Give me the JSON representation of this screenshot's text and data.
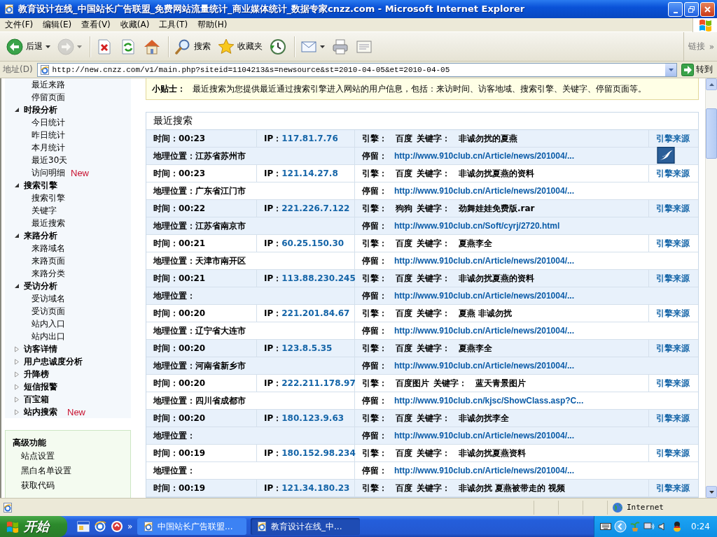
{
  "window": {
    "title": "教育设计在线_中国站长广告联盟_免费网站流量统计_商业媒体统计_数据专家cnzz.com - Microsoft Internet Explorer"
  },
  "menu": [
    "文件(F)",
    "编辑(E)",
    "查看(V)",
    "收藏(A)",
    "工具(T)",
    "帮助(H)"
  ],
  "toolbar": {
    "buttons": [
      {
        "kind": "back",
        "label": "后退",
        "disabled": false
      },
      {
        "kind": "forward",
        "disabled": true
      },
      {
        "kind": "stop",
        "disabled": false
      },
      {
        "kind": "refresh",
        "disabled": false
      },
      {
        "kind": "home",
        "disabled": false
      },
      {
        "kind": "search",
        "label": "搜索",
        "disabled": false
      },
      {
        "kind": "favorites",
        "label": "收藏夹",
        "disabled": false
      },
      {
        "kind": "history",
        "disabled": false
      },
      {
        "kind": "mail",
        "disabled": false
      },
      {
        "kind": "print",
        "disabled": false
      },
      {
        "kind": "edit",
        "disabled": false
      }
    ],
    "links": "链接",
    "more": "»"
  },
  "address": {
    "label": "地址(D)",
    "value": "http://new.cnzz.com/v1/main.php?siteid=1104213&s=newsource&st=2010-04-05&et=2010-04-05",
    "go": "转到"
  },
  "sidebar": {
    "continued_items": [
      {
        "label": "最近来路"
      },
      {
        "label": "停留页面"
      }
    ],
    "groups": [
      {
        "label": "时段分析",
        "expanded": true,
        "children": [
          {
            "label": "今日统计"
          },
          {
            "label": "昨日统计"
          },
          {
            "label": "本月统计"
          },
          {
            "label": "最近30天"
          },
          {
            "label": "访问明细",
            "badge": "New"
          }
        ]
      },
      {
        "label": "搜索引擎",
        "expanded": true,
        "children": [
          {
            "label": "搜索引擎"
          },
          {
            "label": "关键字"
          },
          {
            "label": "最近搜索"
          }
        ]
      },
      {
        "label": "来路分析",
        "expanded": true,
        "children": [
          {
            "label": "来路域名"
          },
          {
            "label": "来路页面"
          },
          {
            "label": "来路分类"
          }
        ]
      },
      {
        "label": "受访分析",
        "expanded": true,
        "children": [
          {
            "label": "受访域名"
          },
          {
            "label": "受访页面"
          },
          {
            "label": "站内入口"
          },
          {
            "label": "站内出口"
          }
        ]
      },
      {
        "label": "访客详情",
        "expanded": false
      },
      {
        "label": "用户忠诚度分析",
        "expanded": false
      },
      {
        "label": "升降榜",
        "expanded": false
      },
      {
        "label": "短信报警",
        "expanded": false
      },
      {
        "label": "百宝箱",
        "expanded": false
      },
      {
        "label": "站内搜索",
        "expanded": false,
        "badge": "New"
      }
    ],
    "advanced": {
      "title": "高级功能",
      "items": [
        "站点设置",
        "黑白名单设置",
        "获取代码"
      ]
    }
  },
  "tip": {
    "label": "小贴士：",
    "text": "最近搜索为您提供最近通过搜索引擎进入网站的用户信息，包括：来访时间、访客地域、搜索引擎、关键字、停留页面等。"
  },
  "panel": {
    "title": "最近搜索",
    "records": [
      {
        "time": "时间：00:23",
        "ip_label": "IP：",
        "ip": "117.81.7.76",
        "engine_label": "引擎：",
        "engine": "百度",
        "keyword_label": "关键字：",
        "keyword": "非诚勿扰的夏燕",
        "source": "引擎来源",
        "location": "地理位置：江苏省苏州市",
        "stay_label": "停留：",
        "stay": "http://www.910club.cn/Article/news/201004/..."
      },
      {
        "time": "时间：00:23",
        "ip_label": "IP：",
        "ip": "121.14.27.8",
        "engine_label": "引擎：",
        "engine": "百度",
        "keyword_label": "关键字：",
        "keyword": "非诚勿扰夏燕的资料",
        "source": "引擎来源",
        "location": "地理位置：广东省江门市",
        "stay_label": "停留：",
        "stay": "http://www.910club.cn/Article/news/201004/..."
      },
      {
        "time": "时间：00:22",
        "ip_label": "IP：",
        "ip": "221.226.7.122",
        "engine_label": "引擎：",
        "engine": "狗狗",
        "keyword_label": "关键字：",
        "keyword": "劲舞娃娃免费版.rar",
        "source": "引擎来源",
        "location": "地理位置：江苏省南京市",
        "stay_label": "停留：",
        "stay": "http://www.910club.cn/Soft/cyrj/2720.html"
      },
      {
        "time": "时间：00:21",
        "ip_label": "IP：",
        "ip": "60.25.150.30",
        "engine_label": "引擎：",
        "engine": "百度",
        "keyword_label": "关键字：",
        "keyword": "夏燕李全",
        "source": "引擎来源",
        "location": "地理位置：天津市南开区",
        "stay_label": "停留：",
        "stay": "http://www.910club.cn/Article/news/201004/..."
      },
      {
        "time": "时间：00:21",
        "ip_label": "IP：",
        "ip": "113.88.230.245",
        "engine_label": "引擎：",
        "engine": "百度",
        "keyword_label": "关键字：",
        "keyword": "非诚勿扰夏燕的资料",
        "source": "引擎来源",
        "location": "地理位置：",
        "stay_label": "停留：",
        "stay": "http://www.910club.cn/Article/news/201004/..."
      },
      {
        "time": "时间：00:20",
        "ip_label": "IP：",
        "ip": "221.201.84.67",
        "engine_label": "引擎：",
        "engine": "百度",
        "keyword_label": "关键字：",
        "keyword": "夏燕 非诚勿扰",
        "source": "引擎来源",
        "location": "地理位置：辽宁省大连市",
        "stay_label": "停留：",
        "stay": "http://www.910club.cn/Article/news/201004/..."
      },
      {
        "time": "时间：00:20",
        "ip_label": "IP：",
        "ip": "123.8.5.35",
        "engine_label": "引擎：",
        "engine": "百度",
        "keyword_label": "关键字：",
        "keyword": "夏燕李全",
        "source": "引擎来源",
        "location": "地理位置：河南省新乡市",
        "stay_label": "停留：",
        "stay": "http://www.910club.cn/Article/news/201004/..."
      },
      {
        "time": "时间：00:20",
        "ip_label": "IP：",
        "ip": "222.211.178.97",
        "engine_label": "引擎：",
        "engine": "百度图片",
        "keyword_label": "关键字：",
        "keyword": "蓝天青景图片",
        "source": "引擎来源",
        "location": "地理位置：四川省成都市",
        "stay_label": "停留：",
        "stay": "http://www.910club.cn/kjsc/ShowClass.asp?C..."
      },
      {
        "time": "时间：00:20",
        "ip_label": "IP：",
        "ip": "180.123.9.63",
        "engine_label": "引擎：",
        "engine": "百度",
        "keyword_label": "关键字：",
        "keyword": "非诚勿扰李全",
        "source": "引擎来源",
        "location": "地理位置：",
        "stay_label": "停留：",
        "stay": "http://www.910club.cn/Article/news/201004/..."
      },
      {
        "time": "时间：00:19",
        "ip_label": "IP：",
        "ip": "180.152.98.234",
        "engine_label": "引擎：",
        "engine": "百度",
        "keyword_label": "关键字：",
        "keyword": "非诚勿扰夏燕资料",
        "source": "引擎来源",
        "location": "地理位置：",
        "stay_label": "停留：",
        "stay": "http://www.910club.cn/Article/news/201004/..."
      },
      {
        "time": "时间：00:19",
        "ip_label": "IP：",
        "ip": "121.34.180.23",
        "engine_label": "引擎：",
        "engine": "百度",
        "keyword_label": "关键字：",
        "keyword": "非诚勿扰 夏燕被带走的 视频",
        "source": "引擎来源"
      }
    ]
  },
  "status_bar": {
    "zone": "Internet"
  },
  "taskbar": {
    "start": "开始",
    "more": "»",
    "tasks": [
      {
        "label": "中国站长广告联盟...",
        "selected": false
      },
      {
        "label": "教育设计在线_中...",
        "selected": true
      }
    ],
    "clock": "0:24"
  }
}
